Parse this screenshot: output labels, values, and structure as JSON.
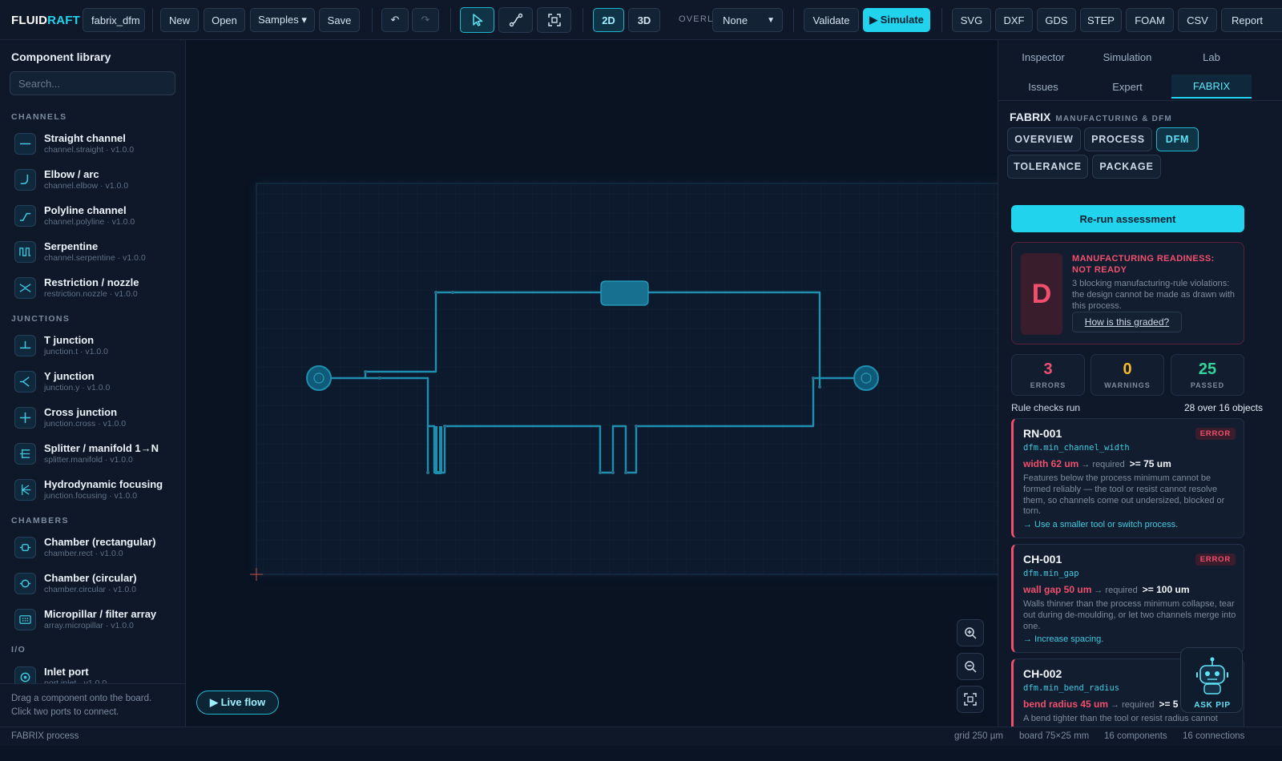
{
  "brand": {
    "part1": "FLUID",
    "part2": "RAFT"
  },
  "toolbar": {
    "project_name": "fabrix_dfm",
    "new_label": "New",
    "open_label": "Open",
    "samples_label": "Samples ▾",
    "save_label": "Save",
    "undo_label": "↶",
    "redo_label": "↷",
    "view_2d": "2D",
    "view_3d": "3D",
    "overlay_label": "OVERLAY",
    "overlay_value": "None",
    "validate_label": "Validate",
    "simulate_label": "▶ Simulate",
    "export": [
      "SVG",
      "DXF",
      "GDS",
      "STEP",
      "FOAM",
      "CSV",
      "Report"
    ]
  },
  "library": {
    "title": "Component library",
    "search_placeholder": "Search...",
    "categories": [
      {
        "name": "CHANNELS",
        "items": [
          {
            "name": "Straight channel",
            "id": "channel.straight · v1.0.0",
            "icon": "straight-icon"
          },
          {
            "name": "Elbow / arc",
            "id": "channel.elbow · v1.0.0",
            "icon": "elbow-icon"
          },
          {
            "name": "Polyline channel",
            "id": "channel.polyline · v1.0.0",
            "icon": "polyline-icon"
          },
          {
            "name": "Serpentine",
            "id": "channel.serpentine · v1.0.0",
            "icon": "serpentine-icon"
          },
          {
            "name": "Restriction / nozzle",
            "id": "restriction.nozzle · v1.0.0",
            "icon": "nozzle-icon"
          }
        ]
      },
      {
        "name": "JUNCTIONS",
        "items": [
          {
            "name": "T junction",
            "id": "junction.t · v1.0.0",
            "icon": "t-junction-icon"
          },
          {
            "name": "Y junction",
            "id": "junction.y · v1.0.0",
            "icon": "y-junction-icon"
          },
          {
            "name": "Cross junction",
            "id": "junction.cross · v1.0.0",
            "icon": "cross-junction-icon"
          },
          {
            "name": "Splitter / manifold 1→N",
            "id": "splitter.manifold · v1.0.0",
            "icon": "splitter-icon"
          },
          {
            "name": "Hydrodynamic focusing",
            "id": "junction.focusing · v1.0.0",
            "icon": "focusing-icon"
          }
        ]
      },
      {
        "name": "CHAMBERS",
        "items": [
          {
            "name": "Chamber (rectangular)",
            "id": "chamber.rect · v1.0.0",
            "icon": "chamber-rect-icon"
          },
          {
            "name": "Chamber (circular)",
            "id": "chamber.circular · v1.0.0",
            "icon": "chamber-circle-icon"
          },
          {
            "name": "Micropillar / filter array",
            "id": "array.micropillar · v1.0.0",
            "icon": "micropillar-icon"
          }
        ]
      },
      {
        "name": "I/O",
        "items": [
          {
            "name": "Inlet port",
            "id": "port.inlet · v1.0.0",
            "icon": "inlet-icon"
          }
        ]
      }
    ],
    "footer_line1": "Drag a component onto the board.",
    "footer_line2": "Click two ports to connect."
  },
  "canvas": {
    "live_flow_label": "▶ Live flow"
  },
  "panel": {
    "tabs_row1": [
      "Inspector",
      "Simulation",
      "Lab"
    ],
    "tabs_row2": [
      "Issues",
      "Expert",
      "FABRIX"
    ],
    "title": "FABRIX",
    "subtitle": "MANUFACTURING & DFM",
    "process_tabs": [
      "OVERVIEW",
      "PROCESS",
      "DFM",
      "TOLERANCE",
      "PACKAGE"
    ],
    "rerun_label": "Re-run assessment",
    "grade": "D",
    "readiness_title": "MANUFACTURING READINESS: NOT READY",
    "readiness_desc": "3 blocking manufacturing-rule violations: the design cannot be made as drawn with this process.",
    "how_graded": "How is this graded?",
    "stats": [
      {
        "value": "3",
        "label": "ERRORS",
        "color": "#f0506e"
      },
      {
        "value": "0",
        "label": "WARNINGS",
        "color": "#f5b82e"
      },
      {
        "value": "25",
        "label": "PASSED",
        "color": "#34d399"
      }
    ],
    "rules_label": "Rule checks run",
    "rules_value": "28 over 16 objects",
    "issues": [
      {
        "id": "RN-001",
        "severity": "ERROR",
        "rule": "dfm.min_channel_width",
        "measured": "width 62 um",
        "arrow": "→ required",
        "required": ">= 75 um",
        "desc": "Features below the process minimum cannot be formed reliably — the tool or resist cannot resolve them, so channels come out undersized, blocked or torn.",
        "fix": "→ Use a smaller tool or switch process."
      },
      {
        "id": "CH-001",
        "severity": "ERROR",
        "rule": "dfm.min_gap",
        "measured": "wall gap 50 um",
        "arrow": "→ required",
        "required": ">= 100 um",
        "desc": "Walls thinner than the process minimum collapse, tear out during de-moulding, or let two channels merge into one.",
        "fix": "→ Increase spacing."
      },
      {
        "id": "CH-002",
        "severity": "ERROR",
        "rule": "dfm.min_bend_radius",
        "measured": "bend radius 45 um",
        "arrow": "→ required",
        "required": ">= 5",
        "desc": "A bend tighter than the tool or resist radius cannot",
        "fix": ""
      }
    ],
    "pip_label": "ASK PIP"
  },
  "status": {
    "left": "FABRIX process",
    "grid": "grid 250 µm",
    "board": "board 75×25 mm",
    "components": "16 components",
    "connections": "16 connections"
  },
  "colors": {
    "accent": "#22d3ee",
    "error": "#f0506e",
    "warning": "#f5b82e",
    "pass": "#34d399",
    "channel": "#1f8fb0"
  }
}
